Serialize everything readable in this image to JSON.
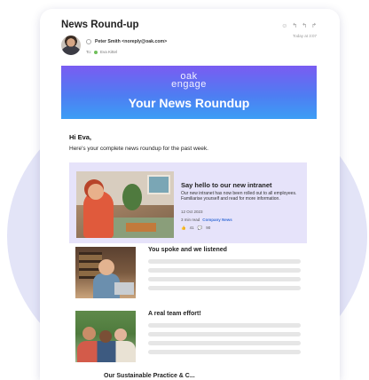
{
  "email": {
    "subject": "News Round-up",
    "timestamp": "Today at 3:07",
    "sender": "Peter Smith <noreply@oak.com>",
    "to_label": "To:",
    "to_value": "Eva Kittel"
  },
  "toolbar": {
    "icons": [
      "smiley-icon",
      "reply-icon",
      "reply-all-icon",
      "forward-icon"
    ]
  },
  "banner": {
    "logo_line1": "oak",
    "logo_line2": "engage",
    "title": "Your News Roundup",
    "gradient": [
      "#7a5cf2",
      "#3c9ef5"
    ]
  },
  "body": {
    "greeting": "Hi Eva,",
    "intro": "Here's your complete news roundup for the past week."
  },
  "feature": {
    "title": "Say hello to our new intranet",
    "text": "Our new intranet has now been rolled out to all employees. Familiarise yourself and read for more information.",
    "date": "12 Oct 2023",
    "read_time": "3 min read",
    "category": "Company News",
    "likes": "41",
    "comments": "90",
    "background": "#e6e3fa"
  },
  "articles": [
    {
      "title": "You spoke and we listened"
    },
    {
      "title": "A real team effort!"
    }
  ],
  "partial_article_title": "Our Sustainable Practice & C..."
}
